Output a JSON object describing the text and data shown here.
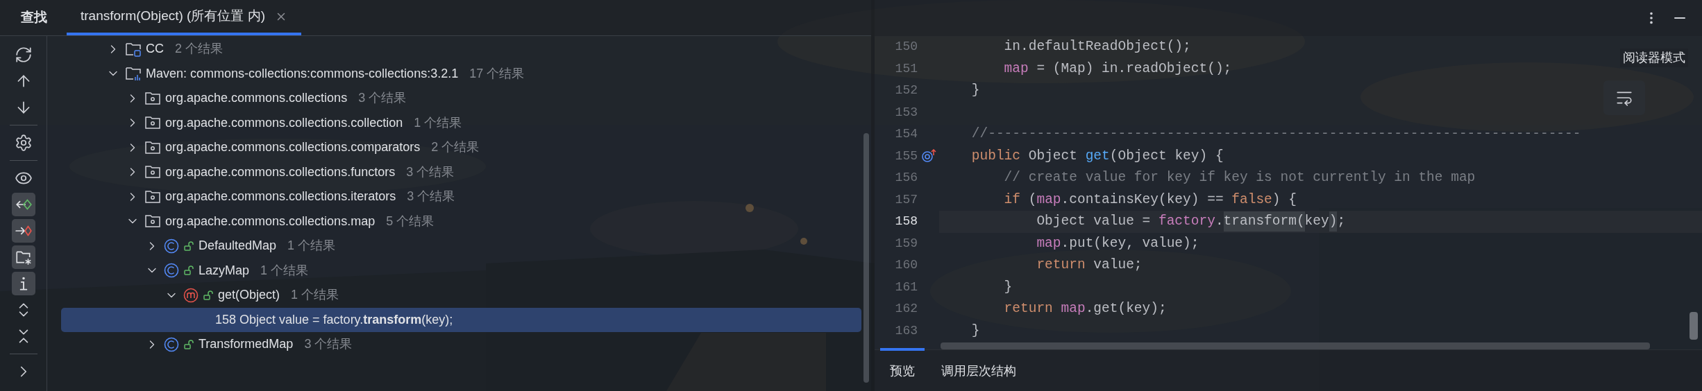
{
  "find_panel": {
    "title": "查找",
    "tabs": [
      {
        "label": "transform(Object) (所有位置 内)",
        "selected": true
      }
    ],
    "toolbar_groups": [
      {
        "items": [
          {
            "kind": "refresh",
            "on": false
          },
          {
            "kind": "up",
            "on": false
          },
          {
            "kind": "down",
            "on": false
          }
        ]
      },
      {
        "items": [
          {
            "kind": "settings",
            "on": false
          }
        ]
      },
      {
        "items": [
          {
            "kind": "preview",
            "on": false
          },
          {
            "kind": "read-access",
            "on": true
          },
          {
            "kind": "write-access",
            "on": true
          },
          {
            "kind": "folder",
            "on": true
          },
          {
            "kind": "info",
            "on": true
          },
          {
            "kind": "expand",
            "on": false
          },
          {
            "kind": "collapse",
            "on": false
          }
        ]
      },
      {
        "items": [
          {
            "kind": "more",
            "on": false
          }
        ]
      }
    ],
    "tree": [
      {
        "kind": "module",
        "label": "CC",
        "count": "2 个结果",
        "expanded": false,
        "selected": false
      },
      {
        "kind": "library",
        "label": "Maven: commons-collections:commons-collections:3.2.1",
        "count": "17 个结果",
        "expanded": true,
        "selected": false,
        "children": [
          {
            "kind": "package",
            "label": "org.apache.commons.collections",
            "count": "3 个结果",
            "expanded": false,
            "selected": false
          },
          {
            "kind": "package",
            "label": "org.apache.commons.collections.collection",
            "count": "1 个结果",
            "expanded": false,
            "selected": false
          },
          {
            "kind": "package",
            "label": "org.apache.commons.collections.comparators",
            "count": "2 个结果",
            "expanded": false,
            "selected": false
          },
          {
            "kind": "package",
            "label": "org.apache.commons.collections.functors",
            "count": "3 个结果",
            "expanded": false,
            "selected": false
          },
          {
            "kind": "package",
            "label": "org.apache.commons.collections.iterators",
            "count": "3 个结果",
            "expanded": false,
            "selected": false
          },
          {
            "kind": "package",
            "label": "org.apache.commons.collections.map",
            "count": "5 个结果",
            "expanded": true,
            "selected": false,
            "children": [
              {
                "kind": "class",
                "label": "DefaultedMap",
                "count": "1 个结果",
                "expanded": false,
                "selected": false
              },
              {
                "kind": "class",
                "label": "LazyMap",
                "count": "1 个结果",
                "expanded": true,
                "selected": false,
                "children": [
                  {
                    "kind": "method",
                    "label": "get(Object)",
                    "count": "1 个结果",
                    "expanded": true,
                    "selected": false,
                    "children": [
                      {
                        "kind": "usage",
                        "label": "158 Object value = factory.**transform**(key);",
                        "selected": true
                      }
                    ]
                  }
                ]
              },
              {
                "kind": "class",
                "label": "TransformedMap",
                "count": "3 个结果",
                "expanded": false,
                "selected": false
              }
            ]
          }
        ]
      }
    ]
  },
  "preview": {
    "reader_mode": "阅读器模式",
    "lines": [
      {
        "number": "150",
        "current": false,
        "tokens": [
          {
            "text": "        in.defaultReadObject();",
            "kind": "plain"
          }
        ]
      },
      {
        "number": "151",
        "current": false,
        "tokens": [
          {
            "text": "        map",
            "kind": "field"
          },
          {
            "text": " = (Map) in.readObject();",
            "kind": "plain"
          }
        ]
      },
      {
        "number": "152",
        "current": false,
        "tokens": [
          {
            "text": "    }",
            "kind": "plain"
          }
        ]
      },
      {
        "number": "153",
        "current": false
      },
      {
        "number": "154",
        "current": false,
        "tokens": [
          {
            "text": "    //-------------------------------------------------------------------------",
            "kind": "comment"
          }
        ]
      },
      {
        "number": "155",
        "current": false,
        "gutter": {
          "kind": "override"
        },
        "tokens": [
          {
            "text": "    public",
            "kind": "keyword"
          },
          {
            "text": " Object ",
            "kind": "plain"
          },
          {
            "text": "get",
            "kind": "method"
          },
          {
            "text": "(Object key) {",
            "kind": "plain"
          }
        ]
      },
      {
        "number": "156",
        "current": false,
        "tokens": [
          {
            "text": "        // create value for key if key is not currently in the map",
            "kind": "comment"
          }
        ]
      },
      {
        "number": "157",
        "current": false,
        "tokens": [
          {
            "text": "        if",
            "kind": "keyword"
          },
          {
            "text": " (",
            "kind": "plain"
          },
          {
            "text": "map",
            "kind": "field"
          },
          {
            "text": ".containsKey(key) == ",
            "kind": "plain"
          },
          {
            "text": "false",
            "kind": "keyword"
          },
          {
            "text": ") {",
            "kind": "plain"
          }
        ]
      },
      {
        "number": "158",
        "current": true,
        "tokens": [
          {
            "text": "            Object value = ",
            "kind": "plain"
          },
          {
            "text": "factory",
            "kind": "field"
          },
          {
            "text": ".",
            "kind": "plain"
          },
          {
            "text": "transform(",
            "kind": "match"
          },
          {
            "text": "key",
            "kind": "plain"
          },
          {
            "text": ")",
            "kind": "match"
          },
          {
            "text": ";",
            "kind": "plain"
          }
        ]
      },
      {
        "number": "159",
        "current": false,
        "tokens": [
          {
            "text": "            map",
            "kind": "field"
          },
          {
            "text": ".put(key, value);",
            "kind": "plain"
          }
        ]
      },
      {
        "number": "160",
        "current": false,
        "tokens": [
          {
            "text": "            return",
            "kind": "keyword"
          },
          {
            "text": " value;",
            "kind": "plain"
          }
        ]
      },
      {
        "number": "161",
        "current": false,
        "tokens": [
          {
            "text": "        }",
            "kind": "plain"
          }
        ]
      },
      {
        "number": "162",
        "current": false,
        "tokens": [
          {
            "text": "        return",
            "kind": "keyword"
          },
          {
            "text": " map",
            "kind": "field"
          },
          {
            "text": ".get(key);",
            "kind": "plain"
          }
        ]
      },
      {
        "number": "163",
        "current": false,
        "tokens": [
          {
            "text": "    }",
            "kind": "plain"
          }
        ]
      }
    ],
    "bottom_tabs": [
      {
        "label": "预览",
        "selected": true
      },
      {
        "label": "调用层次结构",
        "selected": false
      }
    ]
  }
}
